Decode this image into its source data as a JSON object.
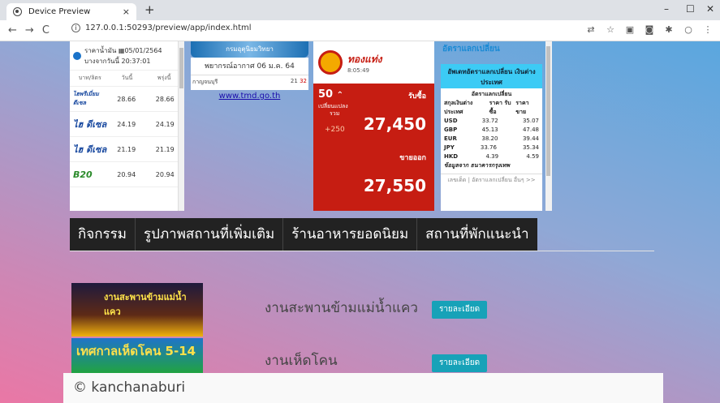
{
  "browser": {
    "tab_title": "Device Preview",
    "tab_close": "×",
    "new_tab": "+",
    "url": "127.0.0.1:50293/preview/app/index.html",
    "win_min": "–",
    "win_max": "☐",
    "win_close": "✕"
  },
  "fuel": {
    "title1": "ราคาน้ำมัน",
    "date": "05/01/2564",
    "title2": "บางจากวันนี้",
    "time": "20:37:01",
    "col_unit": "บาท/ลิตร",
    "col_today": "วันนี้",
    "col_tomorrow": "พรุ่งนี้",
    "rows": [
      {
        "name": "ไฮพรีเมี่ยม ดีเซล",
        "today": "28.66",
        "tomorrow": "28.66"
      },
      {
        "name": "ไฮ ดีเซล",
        "today": "24.19",
        "tomorrow": "24.19"
      },
      {
        "name": "ไฮ ดีเซล",
        "today": "21.19",
        "tomorrow": "21.19"
      },
      {
        "name": "B20",
        "today": "20.94",
        "tomorrow": "20.94"
      }
    ]
  },
  "weather": {
    "banner": "กรมอุตุนิยมวิทยา",
    "forecast": "พยากรณ์อากาศ 06 ม.ค. 64",
    "province": "กาญจนบุรี",
    "low": "21",
    "high": "32",
    "link": "www.tmd.go.th"
  },
  "gold": {
    "brand": "ทองแท่ง",
    "time": "8:05:49",
    "change": "50",
    "change_label": "เปลี่ยนแปลง",
    "total_label": "รวม",
    "total": "+250",
    "buy_label": "รับซื้อ",
    "buy": "27,450",
    "sell_label": "ขายออก",
    "sell": "27,550"
  },
  "fx": {
    "title": "อัตราแลกเปลี่ยน",
    "box_title": "อัพเดทอัตราแลกเปลี่ยน เงินต่างประเทศ",
    "sub": "อัตราแลกเปลี่ยน",
    "h1": "สกุลเงินต่าง ประเทศ",
    "h2": "ราคา รับซื้อ",
    "h3": "ราคา ขาย",
    "rows": [
      {
        "c": "USD",
        "b": "33.72",
        "s": "35.07"
      },
      {
        "c": "GBP",
        "b": "45.13",
        "s": "47.48"
      },
      {
        "c": "EUR",
        "b": "38.20",
        "s": "39.44"
      },
      {
        "c": "JPY",
        "b": "33.76",
        "s": "35.34"
      },
      {
        "c": "HKD",
        "b": "4.39",
        "s": "4.59"
      }
    ],
    "source": "ข้อมูลจาก ธนาคารกรุงเทพ",
    "footer": "เลขเด็ด | อัตราแลกเปลี่ยน อื่นๆ >>"
  },
  "menu": [
    "กิจกรรม",
    "รูปภาพสถานที่เพิ่มเติม",
    "ร้านอาหารยอดนิยม",
    "สถานที่พักแนะนำ"
  ],
  "events": [
    {
      "title": "งานสะพานข้ามแม่น้ำแคว",
      "button": "รายละเอียด",
      "img_text": "งานสะพานข้ามแม่น้ำแคว"
    },
    {
      "title": "งานเห็ดโคน",
      "button": "รายละเอียด",
      "img_text": "เทศกาลเห็ดโคน 5-14"
    }
  ],
  "footer": "© kanchanaburi"
}
